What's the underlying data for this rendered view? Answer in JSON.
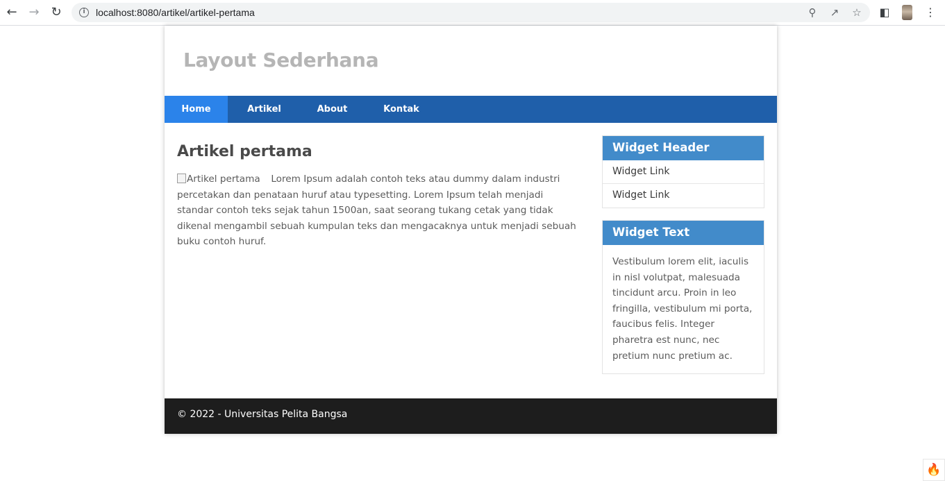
{
  "browser": {
    "url": "localhost:8080/artikel/artikel-pertama",
    "back_icon": "arrow-left-icon",
    "forward_icon": "arrow-right-icon",
    "reload_icon": "reload-icon"
  },
  "site": {
    "title": "Layout Sederhana"
  },
  "nav": {
    "items": [
      {
        "label": "Home",
        "active": true
      },
      {
        "label": "Artikel",
        "active": false
      },
      {
        "label": "About",
        "active": false
      },
      {
        "label": "Kontak",
        "active": false
      }
    ]
  },
  "article": {
    "title": "Artikel pertama",
    "image_alt": "Artikel pertama",
    "body": "Lorem Ipsum adalah contoh teks atau dummy dalam industri percetakan dan penataan huruf atau typesetting. Lorem Ipsum telah menjadi standar contoh teks sejak tahun 1500an, saat seorang tukang cetak yang tidak dikenal mengambil sebuah kumpulan teks dan mengacaknya untuk menjadi sebuah buku contoh huruf."
  },
  "sidebar": {
    "widget_header": {
      "title": "Widget Header",
      "links": [
        "Widget Link",
        "Widget Link"
      ]
    },
    "widget_text": {
      "title": "Widget Text",
      "text": "Vestibulum lorem elit, iaculis in nisl volutpat, malesuada tincidunt arcu. Proin in leo fringilla, vestibulum mi porta, faucibus felis. Integer pharetra est nunc, nec pretium nunc pretium ac."
    }
  },
  "footer": {
    "text": "© 2022 - Universitas Pelita Bangsa"
  },
  "colors": {
    "navbar": "#1f5faa",
    "nav_active": "#2b83ea",
    "widget_header": "#428bca",
    "footer": "#1d1d1d"
  }
}
